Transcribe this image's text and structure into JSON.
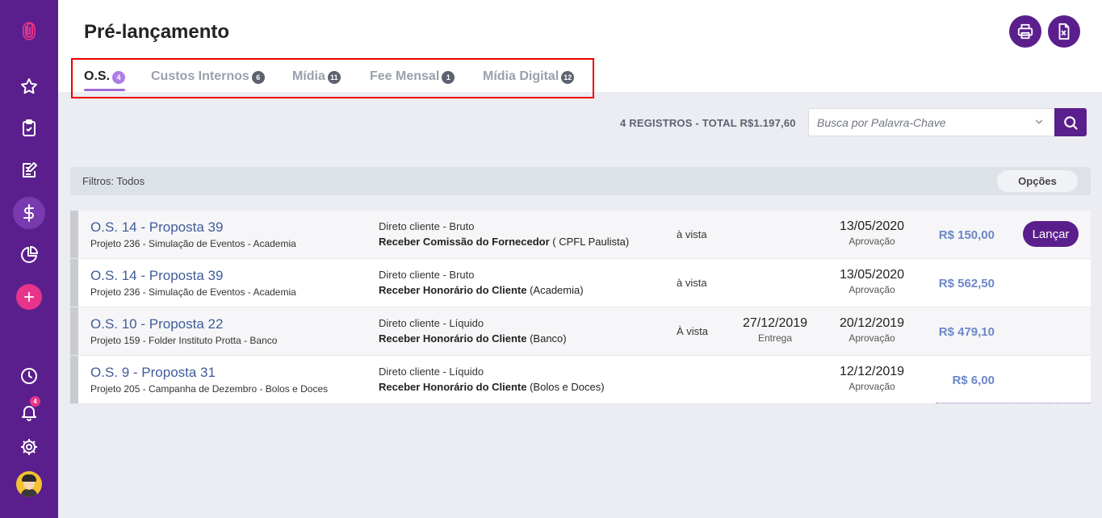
{
  "page": {
    "title": "Pré-lançamento"
  },
  "sidebar": {
    "notifications_badge": "4",
    "items": [
      {
        "name": "logo",
        "icon": "paperclip-logo-icon"
      },
      {
        "name": "favorites",
        "icon": "star-icon"
      },
      {
        "name": "tasks",
        "icon": "clipboard-check-icon"
      },
      {
        "name": "edit",
        "icon": "edit-document-icon"
      },
      {
        "name": "financial",
        "icon": "dollar-icon"
      },
      {
        "name": "reports",
        "icon": "pie-chart-icon"
      },
      {
        "name": "add",
        "icon": "plus-icon"
      },
      {
        "name": "history",
        "icon": "clock-icon"
      },
      {
        "name": "notifications",
        "icon": "bell-icon"
      },
      {
        "name": "settings",
        "icon": "gear-icon"
      },
      {
        "name": "profile",
        "icon": "avatar"
      }
    ]
  },
  "header_actions": {
    "print_icon": "printer-icon",
    "excel_icon": "excel-file-icon"
  },
  "tabs": [
    {
      "label": "O.S.",
      "count": "4",
      "active": true
    },
    {
      "label": "Custos Internos",
      "count": "6",
      "active": false
    },
    {
      "label": "Mídia",
      "count": "11",
      "active": false
    },
    {
      "label": "Fee Mensal",
      "count": "1",
      "active": false
    },
    {
      "label": "Mídia Digital",
      "count": "12",
      "active": false
    }
  ],
  "summary": {
    "totals": "4 REGISTROS - TOTAL R$1.197,60"
  },
  "search": {
    "placeholder": "Busca por Palavra-Chave"
  },
  "filters": {
    "label": "Filtros:",
    "value": "Todos",
    "options_label": "Opções"
  },
  "rows": [
    {
      "title": "O.S. 14 - Proposta 39",
      "subtitle": "Projeto 236 - Simulação de Eventos - Academia",
      "type": "Direto cliente - Bruto",
      "desc_bold": "Receber Comissão do Fornecedor",
      "desc_extra": " ( CPFL Paulista)",
      "payment": "à vista",
      "date2": "",
      "date2_label": "",
      "date": "13/05/2020",
      "date_label": "Aprovação",
      "value": "R$ 150,00",
      "action": "Lançar"
    },
    {
      "title": "O.S. 14 - Proposta 39",
      "subtitle": "Projeto 236 - Simulação de Eventos - Academia",
      "type": "Direto cliente - Bruto",
      "desc_bold": "Receber Honorário do Cliente",
      "desc_extra": " (Academia)",
      "payment": "à vista",
      "date2": "",
      "date2_label": "",
      "date": "13/05/2020",
      "date_label": "Aprovação",
      "value": "R$ 562,50",
      "action": ""
    },
    {
      "title": "O.S. 10 - Proposta 22",
      "subtitle": "Projeto 159 - Folder Instituto Protta - Banco",
      "type": "Direto cliente - Líquido",
      "desc_bold": "Receber Honorário do Cliente",
      "desc_extra": " (Banco)",
      "payment": "À vista",
      "date2": "27/12/2019",
      "date2_label": "Entrega",
      "date": "20/12/2019",
      "date_label": "Aprovação",
      "value": "R$ 479,10",
      "action": ""
    },
    {
      "title": "O.S. 9 - Proposta 31",
      "subtitle": "Projeto 205 - Campanha de Dezembro - Bolos e Doces",
      "type": "Direto cliente - Líquido",
      "desc_bold": "Receber Honorário do Cliente",
      "desc_extra": " (Bolos e Doces)",
      "payment": "",
      "date2": "",
      "date2_label": "",
      "date": "12/12/2019",
      "date_label": "Aprovação",
      "value": "R$ 6,00",
      "action": ""
    }
  ],
  "colors": {
    "brand": "#5a1f8c",
    "accent": "#e8348b",
    "link": "#3f5d9a",
    "value": "#6b87c8"
  }
}
